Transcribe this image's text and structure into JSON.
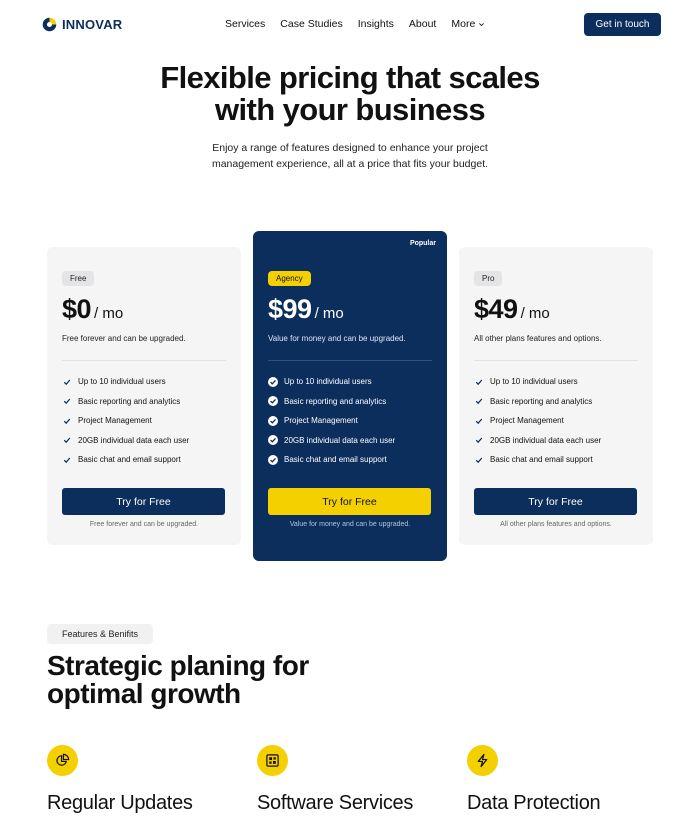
{
  "nav": {
    "brand": "INNOVAR",
    "links": [
      "Services",
      "Case Studies",
      "Insights",
      "About",
      "More"
    ],
    "cta": "Get in touch"
  },
  "hero": {
    "title": "Flexible pricing that scales\nwith your business",
    "subtitle": "Enjoy a range of features designed to enhance your project\nmanagement experience, all at a price that fits your budget."
  },
  "plans": [
    {
      "badge": "Free",
      "price": "$0",
      "period": "/ mo",
      "description": "Free forever and can be upgraded.",
      "features": [
        "Up to 10 individual users",
        "Basic reporting and analytics",
        "Project Management",
        "20GB individual data each user",
        "Basic chat and email support"
      ],
      "button": "Try for Free",
      "footnote": "Free forever and can be upgraded."
    },
    {
      "popular": "Popular",
      "badge": "Agency",
      "price": "$99",
      "period": "/ mo",
      "description": "Value for money and can be upgraded.",
      "features": [
        "Up to 10 individual users",
        "Basic reporting and analytics",
        "Project Management",
        "20GB individual data each user",
        "Basic chat and email support"
      ],
      "button": "Try for Free",
      "footnote": "Value for money and can be upgraded."
    },
    {
      "badge": "Pro",
      "price": "$49",
      "period": "/ mo",
      "description": "All other plans features and options.",
      "features": [
        "Up to 10 individual users",
        "Basic reporting and analytics",
        "Project Management",
        "20GB individual data each user",
        "Basic chat and email support"
      ],
      "button": "Try for Free",
      "footnote": "All other plans features and options."
    }
  ],
  "features_section": {
    "tag": "Features & Benifits",
    "title": "Strategic planing for\noptimal growth",
    "items": [
      {
        "title": "Regular Updates",
        "icon": "pie-chart-icon"
      },
      {
        "title": "Software Services",
        "icon": "qr-code-icon"
      },
      {
        "title": "Data Protection",
        "icon": "lightning-icon"
      }
    ]
  },
  "colors": {
    "navy": "#0b2e5c",
    "yellow": "#f5d000",
    "card_bg": "#f5f5f6"
  }
}
